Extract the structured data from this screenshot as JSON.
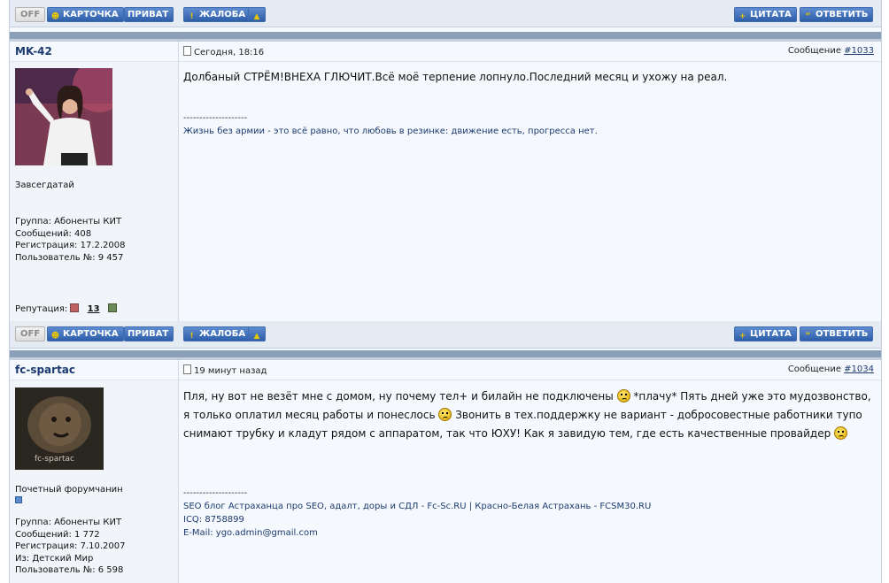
{
  "buttons": {
    "off": "OFF",
    "card": "КАРТОЧКА",
    "private": "ПРИВАТ",
    "report": "ЖАЛОБА",
    "quote": "ЦИТАТА",
    "reply": "ОТВЕТИТЬ"
  },
  "posts": [
    {
      "author": "MK-42",
      "date": "Сегодня, 18:16",
      "msg_label": "Сообщение",
      "msg_no": "#1033",
      "rank": "Завсегдатай",
      "group": "Группа: Абоненты КИТ",
      "messages": "Сообщений: 408",
      "registered": "Регистрация: 17.2.2008",
      "user_no": "Пользователь №: 9 457",
      "reputation_label": "Репутация:",
      "reputation": "13",
      "text": "Долбаный СТРЁМ!ВНЕХА ГЛЮЧИТ.Всё моё терпение лопнуло.Последний месяц и ухожу на реал.",
      "sig_dash": "--------------------",
      "sig_text": "Жизнь без армии - это всё равно, что любовь в резинке: движение есть, прогресса нет."
    },
    {
      "author": "fc-spartac",
      "date": "19 минут назад",
      "msg_label": "Сообщение",
      "msg_no": "#1034",
      "rank": "Почетный форумчанин",
      "group": "Группа: Абоненты КИТ",
      "messages": "Сообщений: 1 772",
      "registered": "Регистрация: 7.10.2007",
      "from": "Из: Детский Мир",
      "user_no": "Пользователь №: 6 598",
      "avatar_caption": "fc-spartac",
      "text_1": "Пля, ну вот не везёт мне с домом, ну почему тел+ и билайн не подключены",
      "text_2": "*плачу* Пять дней уже это мудозвонство, я только оплатил месяц работы и понеслось",
      "text_3": "Звонить в тех.поддержку не вариант - добросовестные работники тупо снимают трубку и кладут рядом с аппаратом, так что ЮХУ! Как я завидую тем, где есть качественные провайдер",
      "sig_dash": "--------------------",
      "sig_line1": "SEO блог Астраханца про SEO, адалт, доры и СДЛ - Fc-Sc.RU | Красно-Белая Астрахань - FCSM30.RU",
      "sig_line2": "ICQ: 8758899",
      "sig_line3": "E-Mail: ygo.admin@gmail.com"
    }
  ]
}
